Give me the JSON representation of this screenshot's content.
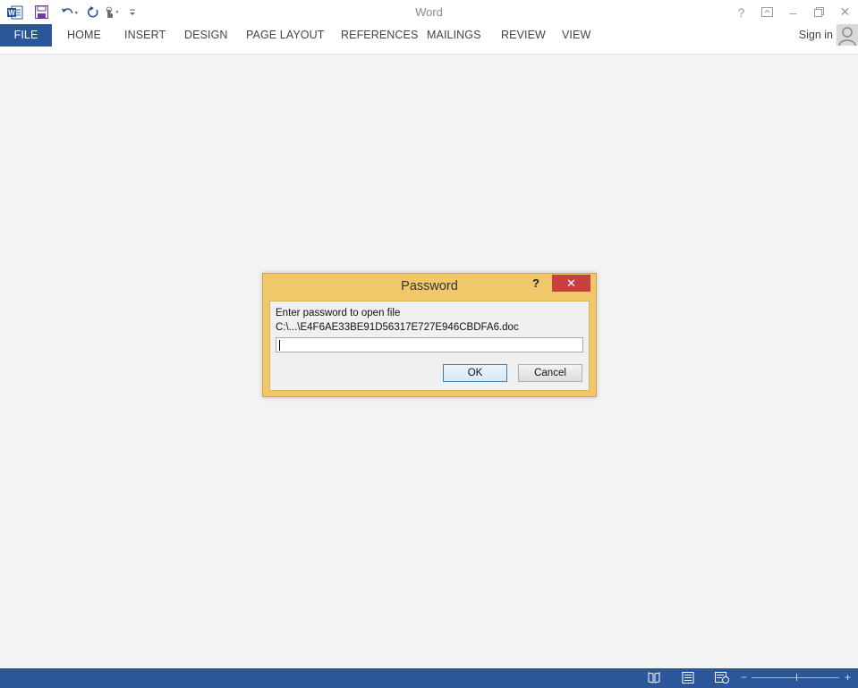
{
  "app": {
    "title": "Word"
  },
  "ribbon": {
    "tabs": [
      "FILE",
      "HOME",
      "INSERT",
      "DESIGN",
      "PAGE LAYOUT",
      "REFERENCES",
      "MAILINGS",
      "REVIEW",
      "VIEW"
    ],
    "sign_in": "Sign in"
  },
  "title_controls": {
    "help": "?",
    "minimize": "–",
    "close": "✕"
  },
  "dialog": {
    "title": "Password",
    "help": "?",
    "close": "✕",
    "prompt": "Enter password to open file",
    "path": "C:\\...\\E4F6AE33BE91D56317E727E946CBDFA6.doc",
    "input_value": "",
    "ok_label": "OK",
    "cancel_label": "Cancel"
  },
  "colors": {
    "accent": "#2b579a",
    "dialog_frame": "#f0c769",
    "close_button": "#c7403d"
  },
  "icons": [
    "word-logo-icon",
    "save-icon",
    "undo-icon",
    "redo-icon",
    "touch-mode-icon",
    "customize-qat-icon",
    "ribbon-display-options-icon",
    "restore-icon",
    "read-mode-icon",
    "print-layout-icon",
    "web-layout-icon"
  ]
}
